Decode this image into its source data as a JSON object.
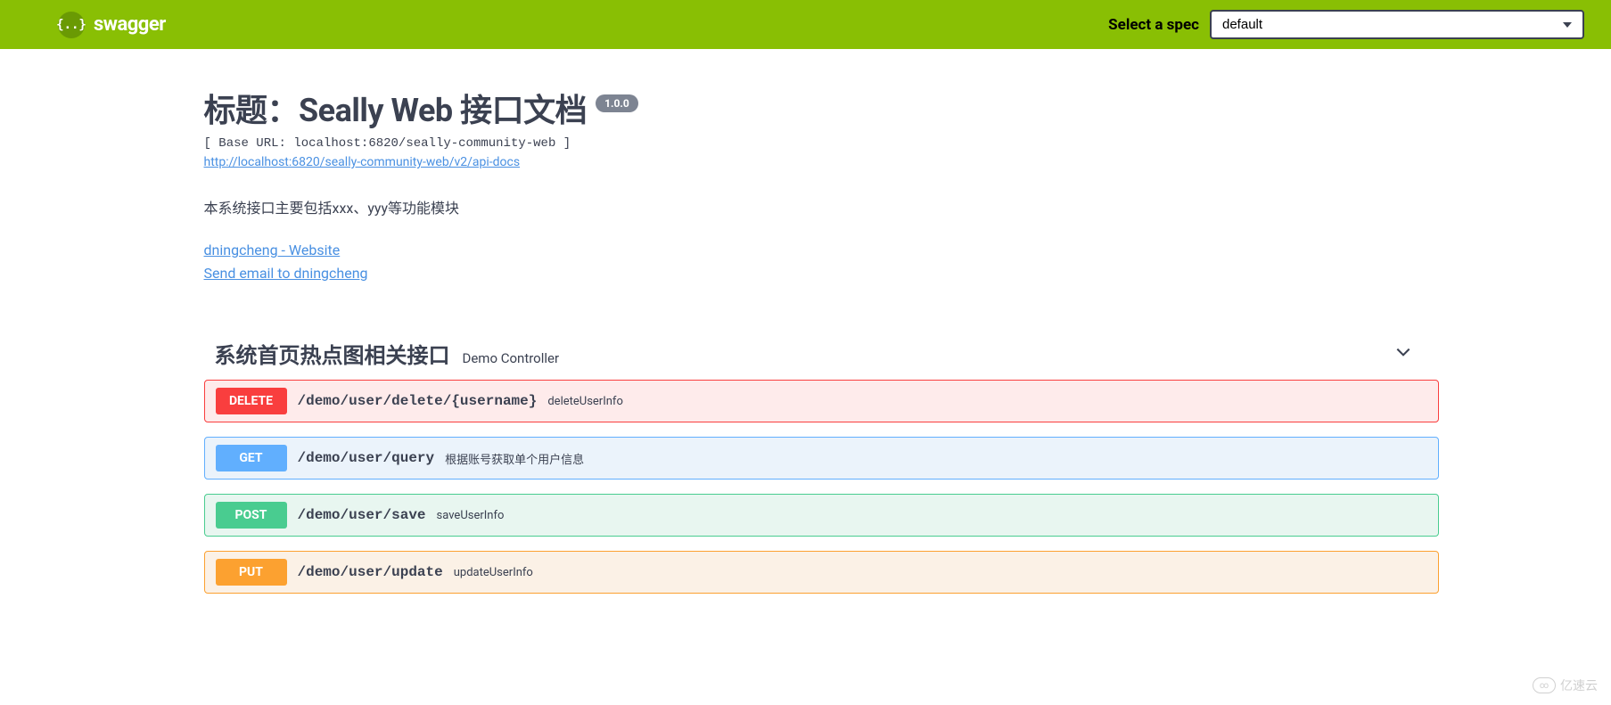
{
  "topbar": {
    "logo_text": "swagger",
    "spec_label": "Select a spec",
    "spec_value": "default"
  },
  "info": {
    "title": "标题：Seally Web 接口文档",
    "version": "1.0.0",
    "base_url": "[ Base URL: localhost:6820/seally-community-web ]",
    "api_docs_url": "http://localhost:6820/seally-community-web/v2/api-docs",
    "description": "本系统接口主要包括xxx、yyy等功能模块",
    "contact_website": "dningcheng - Website",
    "contact_email": "Send email to dningcheng"
  },
  "section": {
    "name": "系统首页热点图相关接口",
    "description": "Demo Controller"
  },
  "endpoints": [
    {
      "method": "DELETE",
      "method_class": "delete",
      "path": "/demo/user/delete/{username}",
      "summary": "deleteUserInfo"
    },
    {
      "method": "GET",
      "method_class": "get",
      "path": "/demo/user/query",
      "summary": "根据账号获取单个用户信息"
    },
    {
      "method": "POST",
      "method_class": "post",
      "path": "/demo/user/save",
      "summary": "saveUserInfo"
    },
    {
      "method": "PUT",
      "method_class": "put",
      "path": "/demo/user/update",
      "summary": "updateUserInfo"
    }
  ],
  "watermark": "亿速云"
}
